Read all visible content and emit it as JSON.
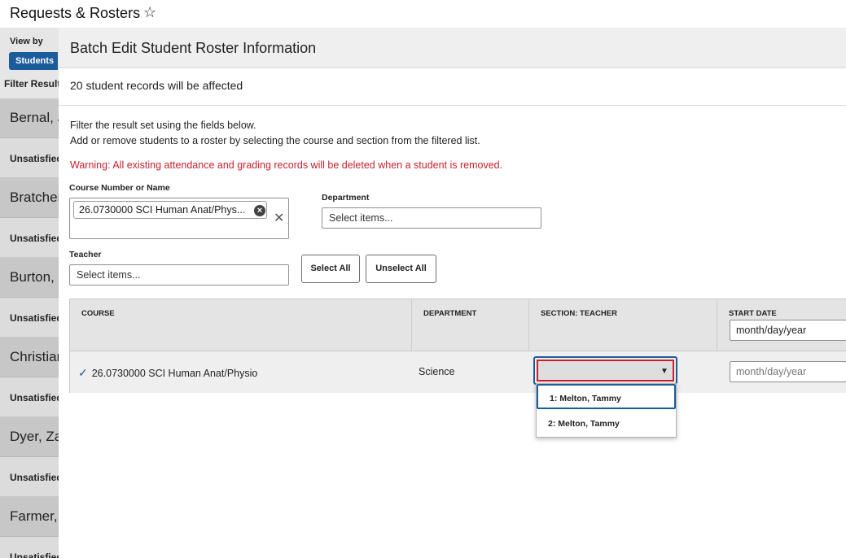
{
  "app": {
    "title": "Requests & Rosters",
    "favorite_icon": "star-outline-icon"
  },
  "left_panel": {
    "view_by_label": "View by",
    "view_by_button": "Students",
    "filter_label": "Filter Results",
    "students": [
      {
        "name": "Bernal, J",
        "status": "Unsatisfied"
      },
      {
        "name": "Bratcher",
        "status": "Unsatisfied"
      },
      {
        "name": "Burton,",
        "status": "Unsatisfied"
      },
      {
        "name": "Christian",
        "status": "Unsatisfied"
      },
      {
        "name": "Dyer, Za",
        "status": "Unsatisfied"
      },
      {
        "name": "Farmer,",
        "status": "Unsatisfied"
      }
    ]
  },
  "modal": {
    "title": "Batch Edit Student Roster Information",
    "affected": "20 student records will be affected",
    "intro_line1": "Filter the result set using the fields below.",
    "intro_line2": "Add or remove students to a roster by selecting the course and section from the filtered list.",
    "warning": "Warning: All existing attendance and grading records will be deleted when a student is removed.",
    "course_label": "Course Number or Name",
    "course_chip": "26.0730000 SCI Human Anat/Phys...",
    "department_label": "Department",
    "department_placeholder": "Select items...",
    "teacher_label": "Teacher",
    "teacher_placeholder": "Select items...",
    "select_all": "Select All",
    "unselect_all": "Unselect All",
    "table": {
      "headers": {
        "course": "COURSE",
        "department": "DEPARTMENT",
        "section": "SECTION: TEACHER",
        "start_date": "START DATE"
      },
      "header_date_value": "month/day/year",
      "row": {
        "course": "26.0730000 SCI Human Anat/Physio",
        "department": "Science",
        "section_value": "",
        "start_date_placeholder": "month/day/year"
      }
    },
    "section_options": [
      "1: Melton, Tammy",
      "2: Melton, Tammy"
    ]
  }
}
